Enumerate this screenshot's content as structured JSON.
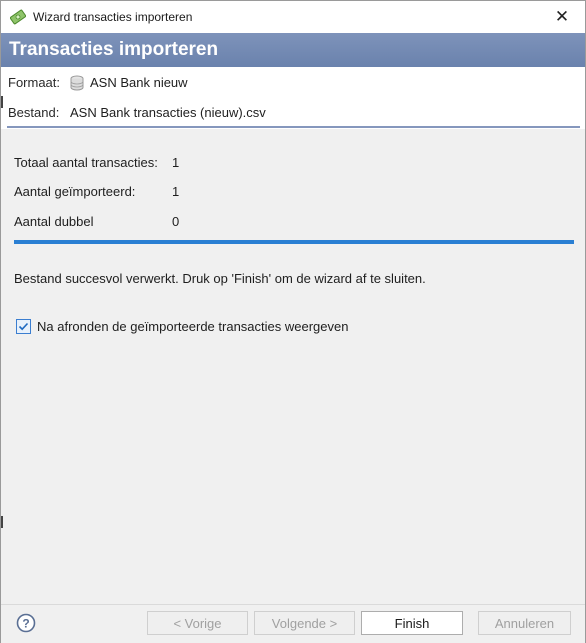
{
  "window": {
    "title": "Wizard transacties importeren",
    "close_glyph": "✕"
  },
  "header": {
    "title": "Transacties importeren"
  },
  "info": {
    "format_label": "Formaat:",
    "format_value": "ASN Bank nieuw",
    "format_icon": "database-icon",
    "file_label": "Bestand:",
    "file_value": "ASN Bank transacties (nieuw).csv"
  },
  "stats": {
    "total_label": "Totaal aantal transacties:",
    "total_value": "1",
    "imported_label": "Aantal geïmporteerd:",
    "imported_value": "1",
    "duplicate_label": "Aantal dubbel",
    "duplicate_value": "0"
  },
  "progress": {
    "fraction": 1.0,
    "color": "#2a7fd3"
  },
  "message": "Bestand succesvol verwerkt. Druk op 'Finish' om de wizard af te sluiten.",
  "option": {
    "label": "Na afronden de geïmporteerde transacties weergeven",
    "checked": true
  },
  "buttons": {
    "prev": "< Vorige",
    "next": "Volgende >",
    "finish": "Finish",
    "cancel": "Annuleren"
  },
  "colors": {
    "header": "#6a82ad",
    "accent": "#2a7fd3"
  }
}
